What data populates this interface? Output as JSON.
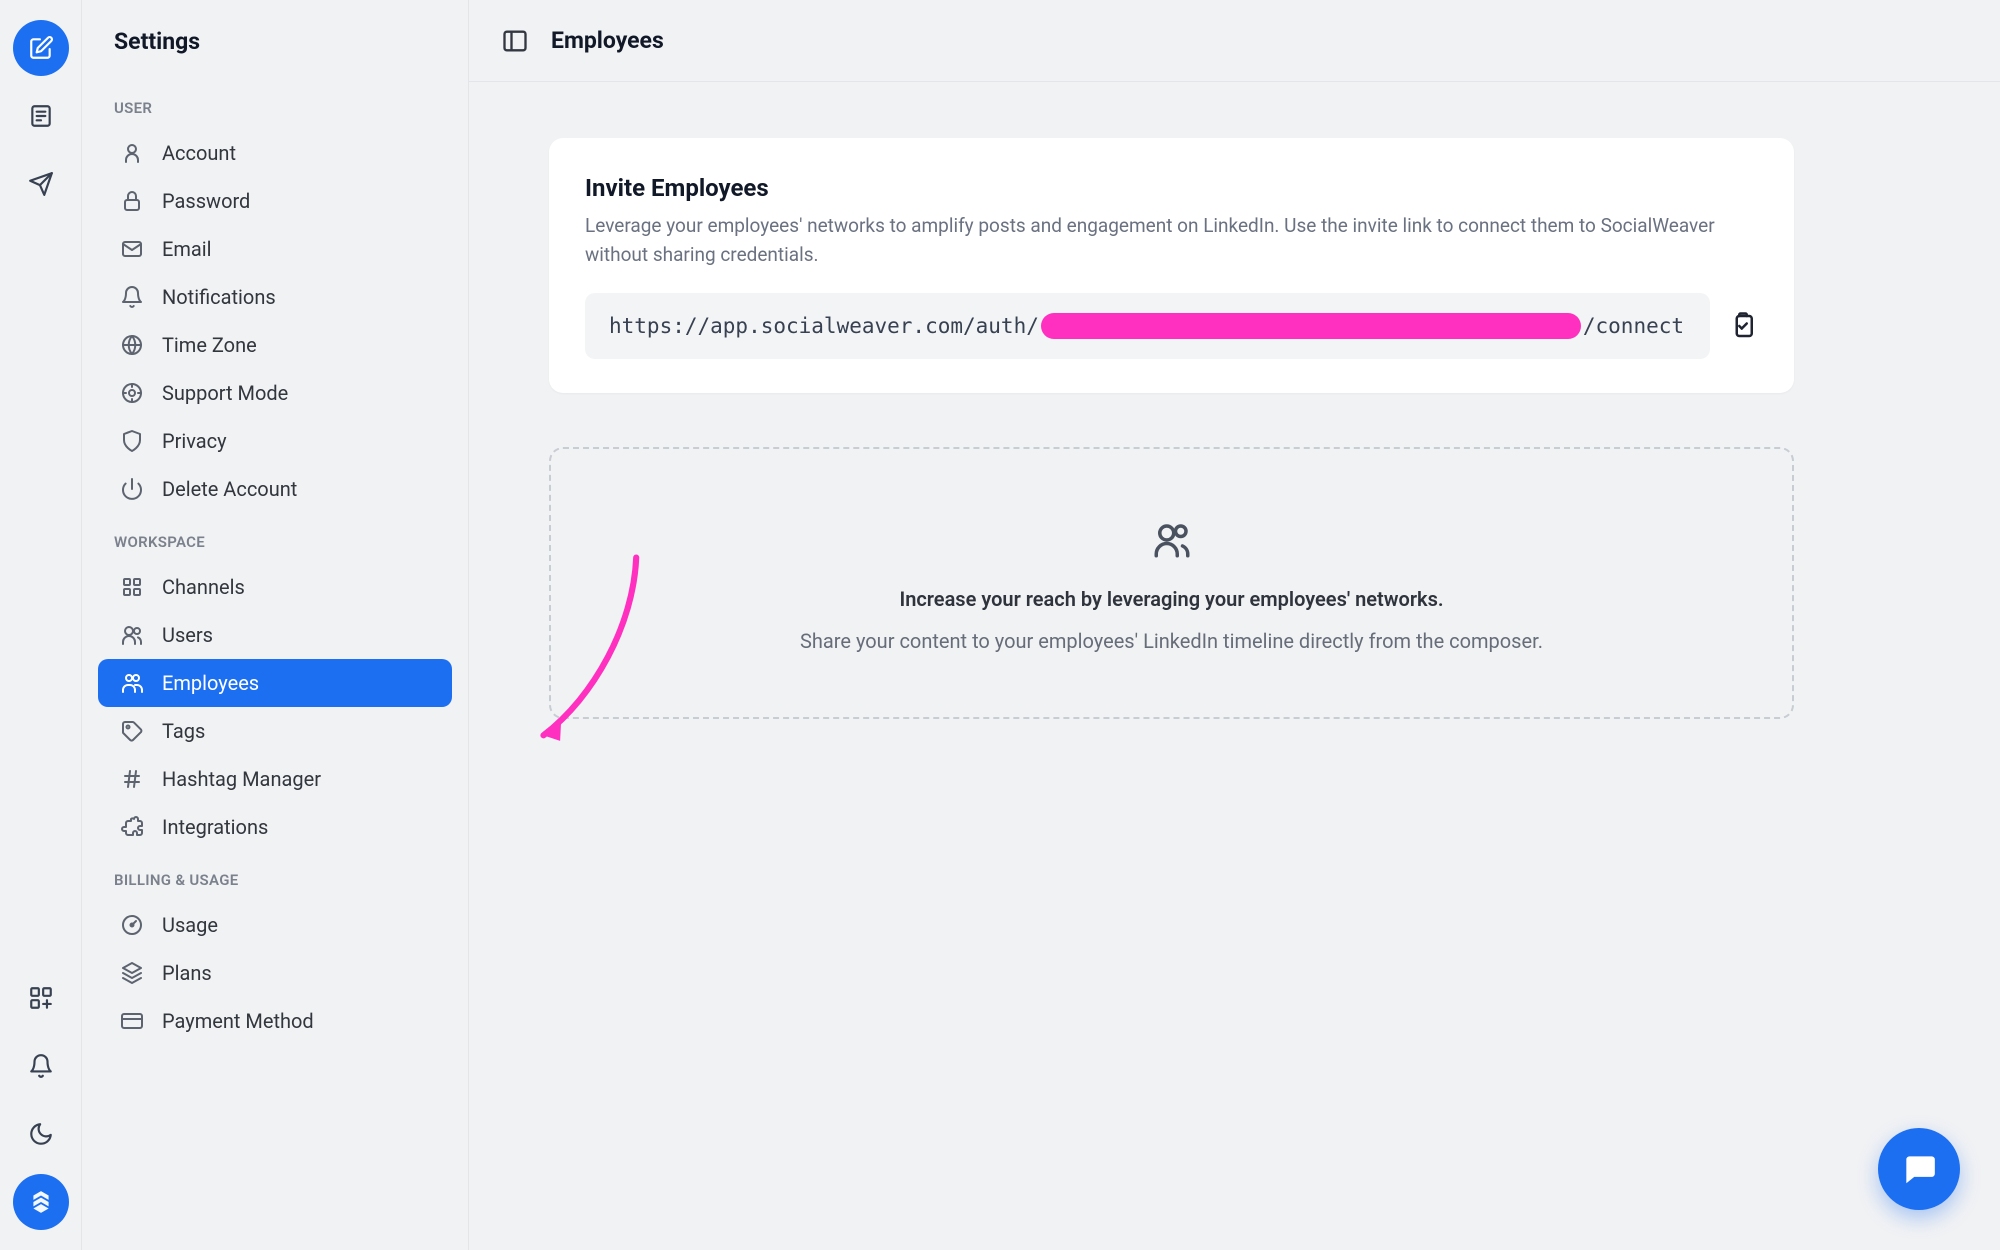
{
  "sidebar_title": "Settings",
  "sections": {
    "user": {
      "label": "USER",
      "items": [
        {
          "label": "Account"
        },
        {
          "label": "Password"
        },
        {
          "label": "Email"
        },
        {
          "label": "Notifications"
        },
        {
          "label": "Time Zone"
        },
        {
          "label": "Support Mode"
        },
        {
          "label": "Privacy"
        },
        {
          "label": "Delete Account"
        }
      ]
    },
    "workspace": {
      "label": "WORKSPACE",
      "items": [
        {
          "label": "Channels"
        },
        {
          "label": "Users"
        },
        {
          "label": "Employees"
        },
        {
          "label": "Tags"
        },
        {
          "label": "Hashtag Manager"
        },
        {
          "label": "Integrations"
        }
      ]
    },
    "billing": {
      "label": "BILLING & USAGE",
      "items": [
        {
          "label": "Usage"
        },
        {
          "label": "Plans"
        },
        {
          "label": "Payment Method"
        }
      ]
    }
  },
  "topbar": {
    "title": "Employees"
  },
  "invite": {
    "title": "Invite Employees",
    "description": "Leverage your employees' networks to amplify posts and engagement on LinkedIn. Use the invite link to connect them to SocialWeaver without sharing credentials.",
    "url_prefix": "https://app.socialweaver.com/auth/",
    "url_suffix": "/connect"
  },
  "empty": {
    "line1": "Increase your reach by leveraging your employees' networks.",
    "line2": "Share your content to your employees' LinkedIn timeline directly from the composer."
  }
}
